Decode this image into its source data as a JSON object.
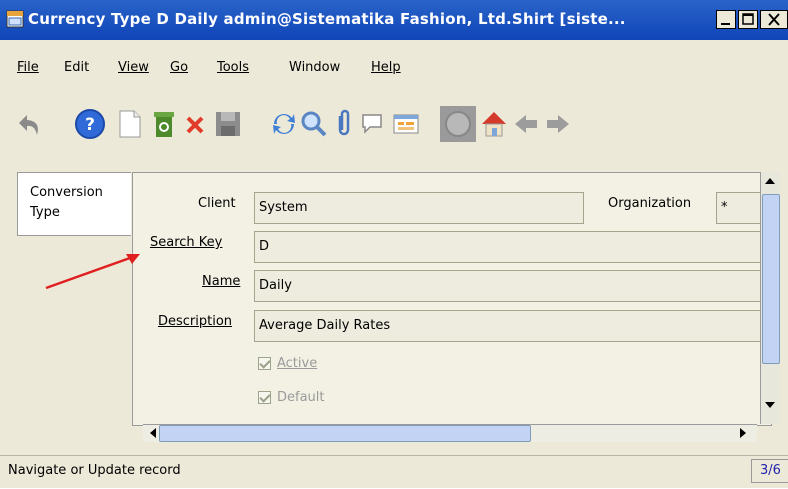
{
  "window": {
    "title": "Currency Type  D  Daily  admin@Sistematika Fashion, Ltd.Shirt [siste...",
    "controls": [
      "_",
      "□",
      "X"
    ]
  },
  "menu": {
    "file": "File",
    "edit": "Edit",
    "view": "View",
    "go": "Go",
    "tools": "Tools",
    "window": "Window",
    "help": "Help"
  },
  "toolbar": {
    "icons": [
      "undo-icon",
      "help-icon",
      "new-record-icon",
      "recycle-bin-icon",
      "delete-icon",
      "save-icon",
      "refresh-icon",
      "find-icon",
      "attachment-icon",
      "chat-icon",
      "report-icon",
      "history-icon",
      "home-icon",
      "back-icon",
      "forward-icon"
    ]
  },
  "tabs": {
    "conversion_type_line1": "Conversion",
    "conversion_type_line2": "Type"
  },
  "form": {
    "client_label": "Client",
    "client_value": "System",
    "organization_label": "Organization",
    "organization_value": "*",
    "search_key_label": "Search Key",
    "search_key_value": "D",
    "name_label": "Name",
    "name_value": "Daily",
    "description_label": "Description",
    "description_value": "Average Daily Rates",
    "active_label": "Active",
    "active_checked": true,
    "default_label": "Default",
    "default_checked": true
  },
  "status": {
    "message": "Navigate or Update record",
    "record_count": "3/6"
  },
  "colors": {
    "titlebar": "#1a52c4",
    "window_bg": "#ece9d8",
    "panel_bg": "#f3f1e4",
    "annotation_arrow": "#e02020"
  }
}
